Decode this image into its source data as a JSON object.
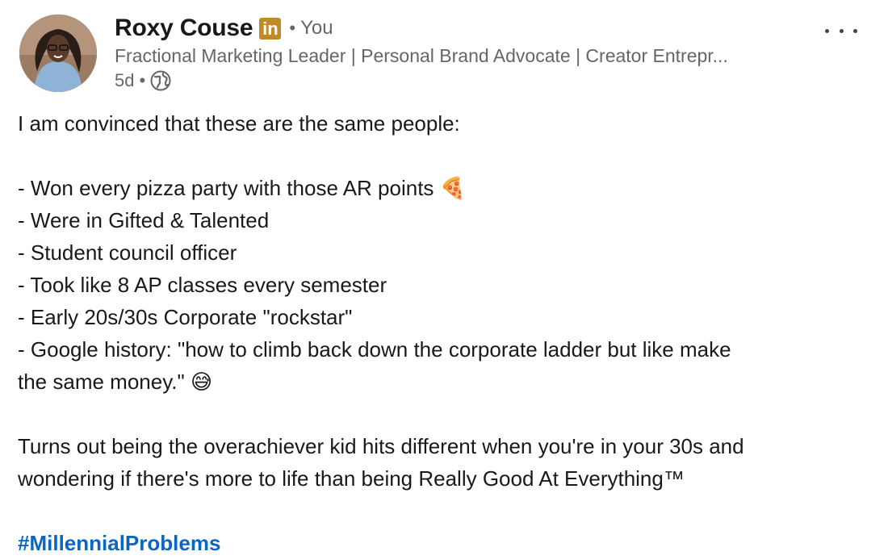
{
  "post": {
    "author": {
      "name": "Roxy Couse",
      "badge": "in",
      "relation_dot": "•",
      "relation": "You",
      "headline": "Fractional Marketing Leader | Personal Brand Advocate | Creator Entrepr...",
      "age": "5d",
      "age_dot": "•",
      "visibility_icon": "globe-icon"
    },
    "more_icon": "ellipsis-icon",
    "content": {
      "intro": "I am convinced that these are the same people:",
      "items": [
        "- Won every pizza party with those AR points 🍕",
        "- Were in Gifted & Talented",
        "- Student council officer",
        "- Took like 8 AP classes every semester",
        "- Early 20s/30s Corporate \"rockstar\"",
        "- Google history: \"how to climb back down the corporate ladder but like make",
        "the same money.\" 😅"
      ],
      "closing_line_1": "Turns out being the overachiever kid hits different when you're in your 30s and",
      "closing_line_2": "wondering if there's more to life than being Really Good At Everything™",
      "hashtag": "#MillennialProblems"
    },
    "colors": {
      "link": "#0a66c2",
      "badge": "#c08a27",
      "secondary_text": "#666666"
    }
  }
}
